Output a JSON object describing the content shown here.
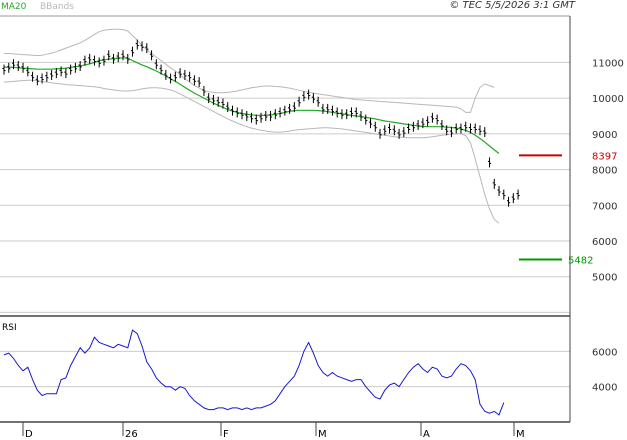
{
  "header": {
    "ma_label": "MA20",
    "bb_label": "BBands",
    "copyright": "© TEC 5/5/2026 3:1 GMT"
  },
  "colors": {
    "ma": "#22aa22",
    "bands": "#b8b8b8",
    "price": "#000000",
    "rsi": "#1a1acc",
    "resistance": "#cc0000",
    "support": "#009900",
    "grid": "#cccccc"
  },
  "chart_data": [
    {
      "type": "line",
      "panel": "price",
      "x_ticks": [
        "D",
        "26",
        "F",
        "M",
        "A",
        "M"
      ],
      "y_ticks": [
        "11000",
        "10000",
        "9000",
        "8000",
        "7000",
        "6000",
        "5000"
      ],
      "ylim": [
        3900,
        12300
      ],
      "levels": [
        {
          "name": "resistance",
          "value": 8397,
          "label": "8397"
        },
        {
          "name": "support",
          "value": 5482,
          "label": "5482"
        }
      ],
      "series": [
        {
          "key": "close",
          "values": [
            10800,
            10850,
            10950,
            10900,
            10850,
            10750,
            10600,
            10500,
            10550,
            10600,
            10650,
            10700,
            10750,
            10700,
            10800,
            10850,
            10900,
            11050,
            11100,
            11050,
            11000,
            11050,
            11200,
            11100,
            11150,
            11200,
            11100,
            11300,
            11500,
            11450,
            11400,
            11200,
            10950,
            10800,
            10650,
            10550,
            10600,
            10700,
            10650,
            10600,
            10500,
            10450,
            10200,
            10000,
            9950,
            9900,
            9850,
            9750,
            9650,
            9600,
            9550,
            9500,
            9450,
            9400,
            9450,
            9500,
            9500,
            9550,
            9600,
            9650,
            9700,
            9750,
            9900,
            10050,
            10100,
            10000,
            9900,
            9700,
            9700,
            9650,
            9600,
            9550,
            9550,
            9600,
            9600,
            9500,
            9400,
            9300,
            9200,
            9000,
            9100,
            9150,
            9100,
            9000,
            9050,
            9150,
            9200,
            9250,
            9300,
            9350,
            9450,
            9400,
            9250,
            9100,
            9050,
            9150,
            9150,
            9200,
            9150,
            9150,
            9100,
            9050,
            8200,
            7600,
            7400,
            7300,
            7100,
            7200,
            7300
          ]
        },
        {
          "key": "ma20",
          "values": [
            10870,
            10870,
            10860,
            10850,
            10840,
            10830,
            10820,
            10810,
            10810,
            10810,
            10810,
            10820,
            10830,
            10840,
            10860,
            10880,
            10900,
            10930,
            10960,
            11000,
            11050,
            11070,
            11090,
            11110,
            11120,
            11130,
            11120,
            11050,
            10990,
            10930,
            10880,
            10820,
            10760,
            10690,
            10620,
            10540,
            10470,
            10390,
            10300,
            10220,
            10140,
            10070,
            10000,
            9930,
            9860,
            9800,
            9740,
            9680,
            9640,
            9600,
            9570,
            9550,
            9530,
            9520,
            9520,
            9520,
            9530,
            9550,
            9570,
            9600,
            9630,
            9650,
            9660,
            9660,
            9660,
            9660,
            9650,
            9640,
            9620,
            9600,
            9580,
            9560,
            9540,
            9520,
            9500,
            9480,
            9460,
            9440,
            9420,
            9390,
            9360,
            9340,
            9320,
            9300,
            9280,
            9260,
            9240,
            9220,
            9210,
            9200,
            9200,
            9200,
            9200,
            9190,
            9180,
            9160,
            9140,
            9100,
            9040,
            8960,
            8870,
            8770,
            8660,
            8550,
            8450
          ]
        },
        {
          "key": "upper_band",
          "values": [
            11250,
            11250,
            11240,
            11230,
            11220,
            11210,
            11200,
            11190,
            11200,
            11230,
            11260,
            11300,
            11350,
            11400,
            11450,
            11500,
            11550,
            11620,
            11700,
            11780,
            11860,
            11900,
            11920,
            11930,
            11930,
            11920,
            11880,
            11750,
            11620,
            11480,
            11350,
            11250,
            11150,
            11050,
            10950,
            10850,
            10760,
            10650,
            10540,
            10450,
            10350,
            10280,
            10220,
            10180,
            10160,
            10150,
            10150,
            10160,
            10180,
            10200,
            10230,
            10260,
            10290,
            10310,
            10330,
            10340,
            10340,
            10330,
            10320,
            10300,
            10280,
            10250,
            10220,
            10190,
            10160,
            10140,
            10120,
            10100,
            10080,
            10060,
            10040,
            10020,
            10000,
            9980,
            9960,
            9950,
            9940,
            9930,
            9920,
            9910,
            9900,
            9890,
            9880,
            9870,
            9860,
            9850,
            9840,
            9830,
            9820,
            9810,
            9800,
            9790,
            9780,
            9770,
            9760,
            9750,
            9700,
            9600,
            9600,
            10000,
            10300,
            10400,
            10350,
            10300
          ]
        },
        {
          "key": "lower_band",
          "values": [
            10450,
            10460,
            10470,
            10480,
            10490,
            10500,
            10500,
            10490,
            10470,
            10450,
            10430,
            10410,
            10400,
            10380,
            10370,
            10360,
            10350,
            10340,
            10330,
            10320,
            10300,
            10270,
            10250,
            10230,
            10210,
            10200,
            10200,
            10210,
            10230,
            10260,
            10280,
            10290,
            10290,
            10280,
            10260,
            10230,
            10180,
            10120,
            10050,
            9980,
            9910,
            9840,
            9770,
            9700,
            9630,
            9560,
            9490,
            9420,
            9360,
            9300,
            9250,
            9200,
            9160,
            9130,
            9100,
            9080,
            9060,
            9050,
            9050,
            9060,
            9080,
            9100,
            9120,
            9130,
            9140,
            9150,
            9160,
            9170,
            9170,
            9160,
            9150,
            9140,
            9120,
            9100,
            9080,
            9060,
            9040,
            9020,
            9000,
            8980,
            8960,
            8940,
            8920,
            8910,
            8900,
            8890,
            8890,
            8890,
            8890,
            8900,
            8920,
            8940,
            8960,
            8980,
            8990,
            9000,
            9000,
            8950,
            8750,
            8300,
            7800,
            7300,
            6900,
            6600,
            6500
          ]
        }
      ]
    },
    {
      "type": "line",
      "panel": "indicator",
      "title": "RSI",
      "y_ticks": [
        "6000",
        "4000"
      ],
      "ylim": [
        20,
        80
      ],
      "series": [
        {
          "key": "rsi",
          "values": [
            58,
            59,
            56,
            52,
            49,
            51,
            44,
            38,
            35,
            36,
            36,
            36,
            44,
            45,
            52,
            57,
            62,
            59,
            62,
            68,
            65,
            64,
            63,
            62,
            64,
            63,
            62,
            72,
            70,
            63,
            54,
            50,
            45,
            42,
            40,
            40,
            38,
            40,
            39,
            35,
            32,
            30,
            28,
            27,
            27,
            28,
            28,
            27,
            28,
            28,
            27,
            28,
            27,
            28,
            28,
            29,
            30,
            32,
            36,
            40,
            43,
            46,
            52,
            60,
            65,
            59,
            52,
            48,
            46,
            48,
            46,
            45,
            44,
            43,
            44,
            44,
            40,
            37,
            34,
            33,
            38,
            41,
            42,
            40,
            44,
            48,
            51,
            53,
            50,
            48,
            51,
            50,
            46,
            45,
            46,
            50,
            53,
            52,
            49,
            44,
            30,
            26,
            25,
            26,
            24,
            31
          ]
        }
      ]
    }
  ]
}
